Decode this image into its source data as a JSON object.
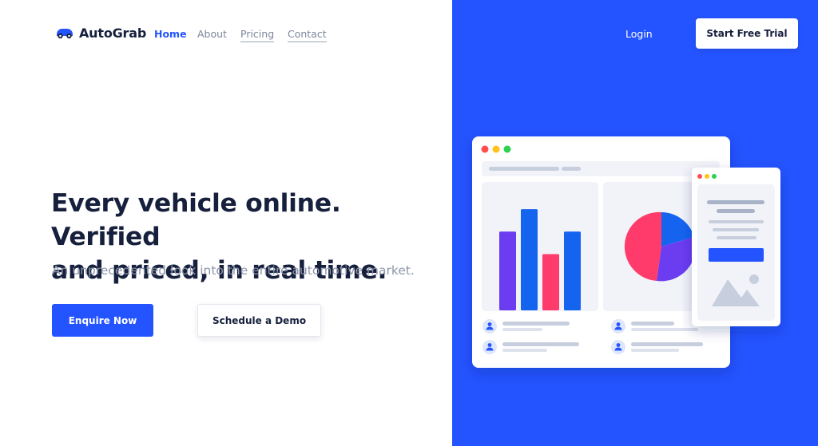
{
  "brand": {
    "name": "AutoGrab",
    "logo_icon": "car-icon"
  },
  "nav": {
    "links": [
      {
        "label": "Home"
      },
      {
        "label": "About"
      },
      {
        "label": "Pricing"
      },
      {
        "label": "Contact"
      }
    ],
    "login_label": "Login",
    "cta_label": "Start Free Trial"
  },
  "hero": {
    "title_line1": "Every vehicle online. Verified",
    "title_line2": "and priced, in real time.",
    "subtitle": "An unprecedented look into the entire automotive market.",
    "primary_button": "Enquire Now",
    "secondary_button": "Schedule a Demo"
  },
  "colors": {
    "accent": "#2454ff",
    "heading": "#16203d",
    "muted": "#8d96aa",
    "bar_purple": "#6b3cf0",
    "bar_blue": "#1464f0",
    "bar_pink": "#ff3b6b",
    "window_red": "#ff4d4d",
    "window_yellow": "#ffc21a",
    "window_green": "#2ed152"
  },
  "illustration": {
    "window_icons": [
      "close-dot-icon",
      "minimize-dot-icon",
      "maximize-dot-icon"
    ],
    "bar_chart_values": [
      0.7,
      0.9,
      0.5,
      0.7
    ],
    "pie_chart_slices": [
      0.42,
      0.25,
      0.33
    ],
    "list_icons": [
      "user-icon",
      "user-icon",
      "user-icon",
      "user-icon"
    ],
    "image_placeholder_icon": "image-icon"
  }
}
